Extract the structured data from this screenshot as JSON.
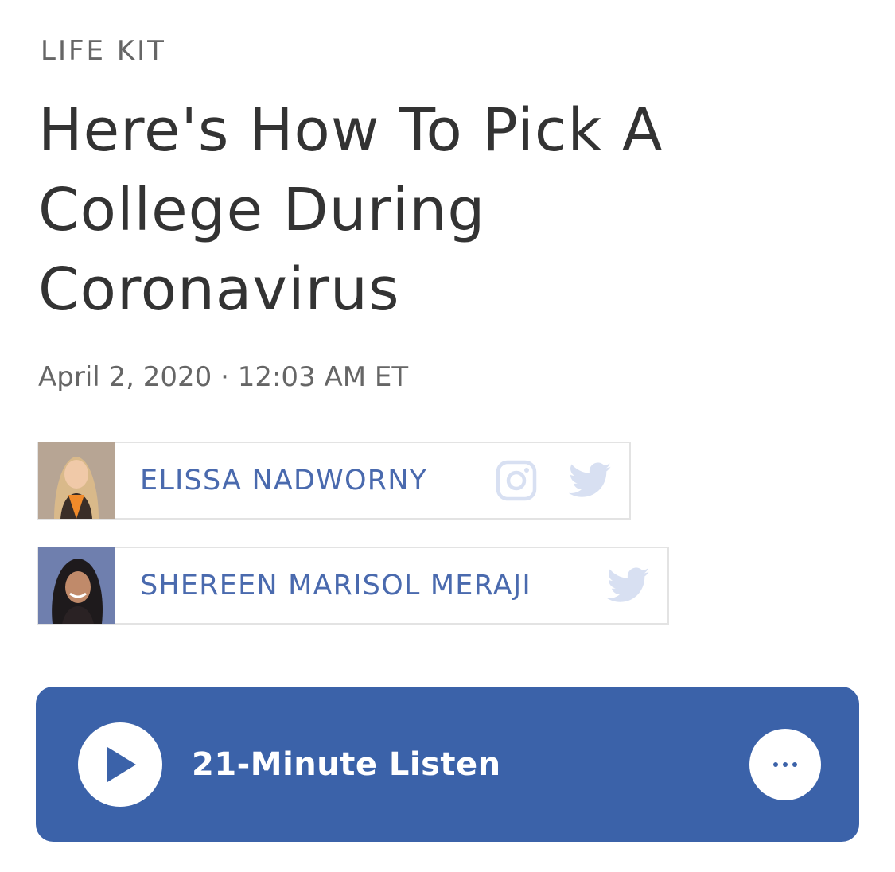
{
  "story": {
    "slug": "LIFE KIT",
    "title": "Here's How To Pick A College During Coronavirus",
    "date": "April 2, 2020 · 12:03 AM ET"
  },
  "bylines": [
    {
      "name": "ELISSA NADWORNY",
      "social": [
        "instagram-icon",
        "twitter-icon"
      ]
    },
    {
      "name": "SHEREEN MARISOL MERAJI",
      "social": [
        "twitter-icon"
      ]
    }
  ],
  "player": {
    "listen_label": "21-Minute Listen",
    "more_label": "..."
  },
  "colors": {
    "accent": "#3b62a9",
    "author_link": "#4a6aae",
    "social_icon": "#d8e0f2"
  }
}
